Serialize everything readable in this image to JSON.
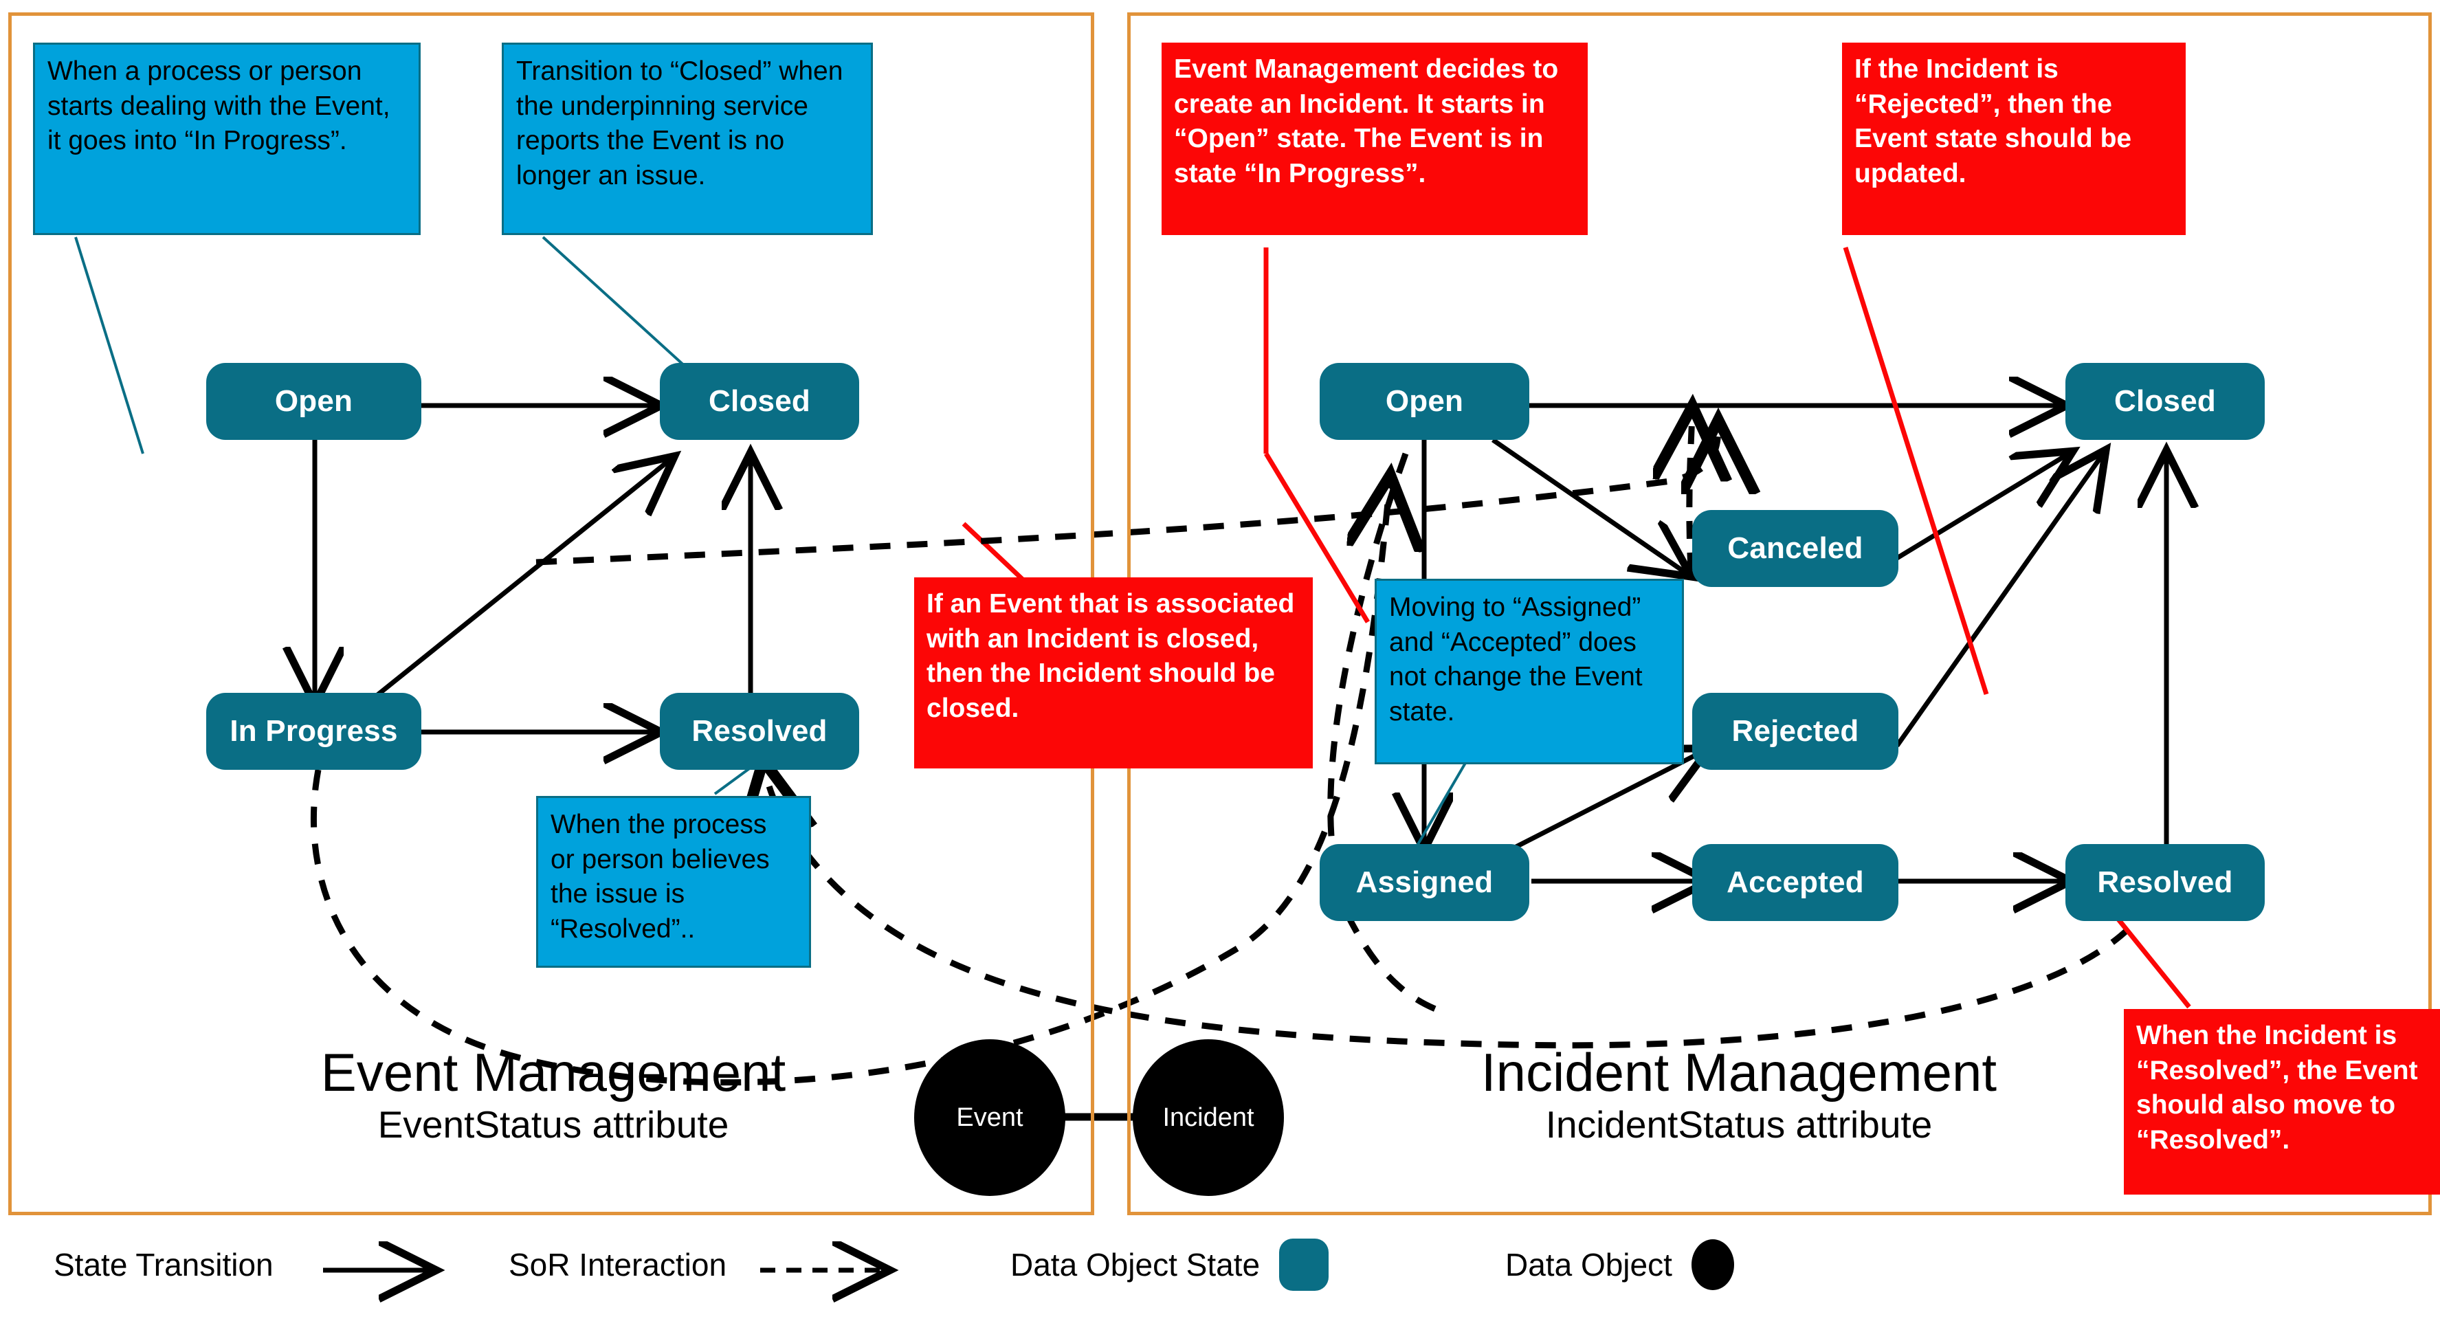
{
  "panels": [
    {
      "id": "event-management",
      "title": "Event Management",
      "subtitle": "EventStatus attribute",
      "accent_color": "#E1933A",
      "states": [
        {
          "id": "open",
          "label": "Open"
        },
        {
          "id": "closed",
          "label": "Closed"
        },
        {
          "id": "in-progress",
          "label": "In Progress"
        },
        {
          "id": "resolved",
          "label": "Resolved"
        }
      ],
      "notes": [
        {
          "id": "note-in-progress",
          "kind": "blue",
          "text": "When a process or person starts dealing with the Event, it goes into “In Progress”."
        },
        {
          "id": "note-closed",
          "kind": "blue",
          "text": "Transition to “Closed” when the underpinning service reports the Event is no longer an issue."
        },
        {
          "id": "note-resolved",
          "kind": "blue",
          "text": "When the process or person believes the issue is “Resolved”.."
        },
        {
          "id": "note-incident-closed",
          "kind": "red",
          "text": "If an Event that is associated with an Incident is closed, then the Incident should be closed."
        }
      ]
    },
    {
      "id": "incident-management",
      "title": "Incident Management",
      "subtitle": "IncidentStatus attribute",
      "accent_color": "#E1933A",
      "states": [
        {
          "id": "open",
          "label": "Open"
        },
        {
          "id": "closed",
          "label": "Closed"
        },
        {
          "id": "canceled",
          "label": "Canceled"
        },
        {
          "id": "rejected",
          "label": "Rejected"
        },
        {
          "id": "assigned",
          "label": "Assigned"
        },
        {
          "id": "accepted",
          "label": "Accepted"
        },
        {
          "id": "resolved",
          "label": "Resolved"
        }
      ],
      "notes": [
        {
          "id": "note-create-incident",
          "kind": "red",
          "text": "Event Management decides to create an Incident. It starts in “Open” state. The Event is in state “In Progress”."
        },
        {
          "id": "note-rejected",
          "kind": "red",
          "text": "If the Incident is “Rejected”, then the Event state should be updated."
        },
        {
          "id": "note-assigned-accepted",
          "kind": "blue",
          "text": "Moving to “Assigned” and “Accepted” does not change the Event state."
        },
        {
          "id": "note-incident-resolved",
          "kind": "red",
          "text": "When the Incident is “Resolved”, the Event should also move to “Resolved”."
        }
      ]
    }
  ],
  "data_objects": [
    {
      "id": "event",
      "label": "Event"
    },
    {
      "id": "incident",
      "label": "Incident"
    }
  ],
  "legend": {
    "items": [
      {
        "id": "state-transition",
        "label": "State Transition",
        "glyph": "solid-arrow-icon"
      },
      {
        "id": "sor-interaction",
        "label": "SoR Interaction",
        "glyph": "dashed-arrow-icon"
      },
      {
        "id": "data-object-state",
        "label": "Data Object State",
        "glyph": "rounded-rect-swatch"
      },
      {
        "id": "data-object",
        "label": "Data Object",
        "glyph": "circle-swatch"
      }
    ]
  },
  "colors": {
    "state_fill": "#0A6E85",
    "note_blue": "#00A2DC",
    "note_red": "#FC0606",
    "panel_border": "#E1933A",
    "data_object": "#000000",
    "connector": "#000000",
    "leader_blue": "#0A6E85",
    "leader_red": "#FC0606"
  }
}
